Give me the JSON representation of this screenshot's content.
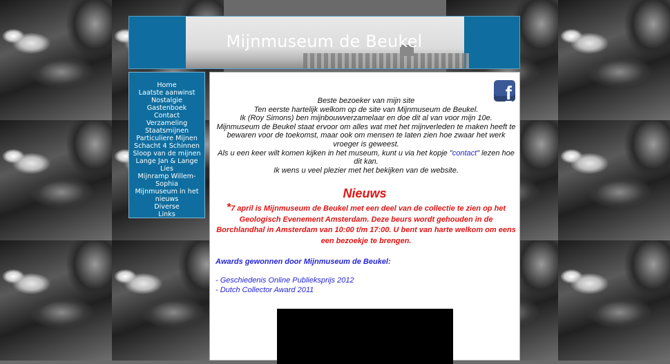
{
  "header": {
    "title": "Mijnmuseum de Beukel"
  },
  "nav": {
    "items": [
      {
        "label": "Home"
      },
      {
        "label": "Laatste aanwinst"
      },
      {
        "label": "Nostalgie"
      },
      {
        "label": "Gastenboek"
      },
      {
        "label": "Contact"
      },
      {
        "label": "Verzameling"
      },
      {
        "label": "Staatsmijnen"
      },
      {
        "label": "Particuliere Mijnen"
      },
      {
        "label": "Schacht 4 Schinnen"
      },
      {
        "label": "Sloop van de mijnen"
      },
      {
        "label": "Lange Jan & Lange Lies"
      },
      {
        "label": "Mijnramp Willem-Sophia"
      },
      {
        "label": "Mijnmuseum in het nieuws"
      },
      {
        "label": "Diverse"
      },
      {
        "label": "Links"
      }
    ]
  },
  "main": {
    "facebook_icon": "facebook-icon",
    "facebook_glyph": "f",
    "intro": {
      "line1": "Beste bezoeker van mijn site",
      "line2": "Ten eerste hartelijk welkom op de site van Mijnmuseum de Beukel.",
      "line3": "Ik (Roy Simons) ben mijnbouwverzamelaar en doe dit al van voor mijn 10e.",
      "line4": "Mijnmuseum de Beukel staat ervoor om alles wat met het mijnverleden te maken heeft te bewaren voor de toekomst, maar ook om mensen te laten zien hoe zwaar het werk vroeger is geweest.",
      "line5_before": "Als u een keer wilt komen kijken in het museum, kunt u via het kopje \"",
      "line5_link": "contact",
      "line5_after": "\" lezen hoe dit kan.",
      "line6": "Ik wens u veel plezier met het bekijken van de website."
    },
    "news": {
      "title": "Nieuws",
      "star": "*",
      "text": "7 april is Mijnmuseum de Beukel met een deel van de collectie te zien op het Geologisch Evenement Amsterdam. Deze beurs wordt gehouden in de Borchlandhal in Amsterdam van 10:00 t/m 17:00. U bent van harte welkom om eens een bezoekje te brengen."
    },
    "awards": {
      "title": "Awards gewonnen door Mijnmuseum de Beukel:",
      "items": [
        "- Geschiedenis Online Publieksprijs 2012",
        "- Dutch Collector Award 2011"
      ]
    }
  },
  "colors": {
    "header_blue": "#0f6e9f",
    "news_red": "#e11313",
    "awards_blue": "#2424d6",
    "link_blue": "#2222cc"
  }
}
